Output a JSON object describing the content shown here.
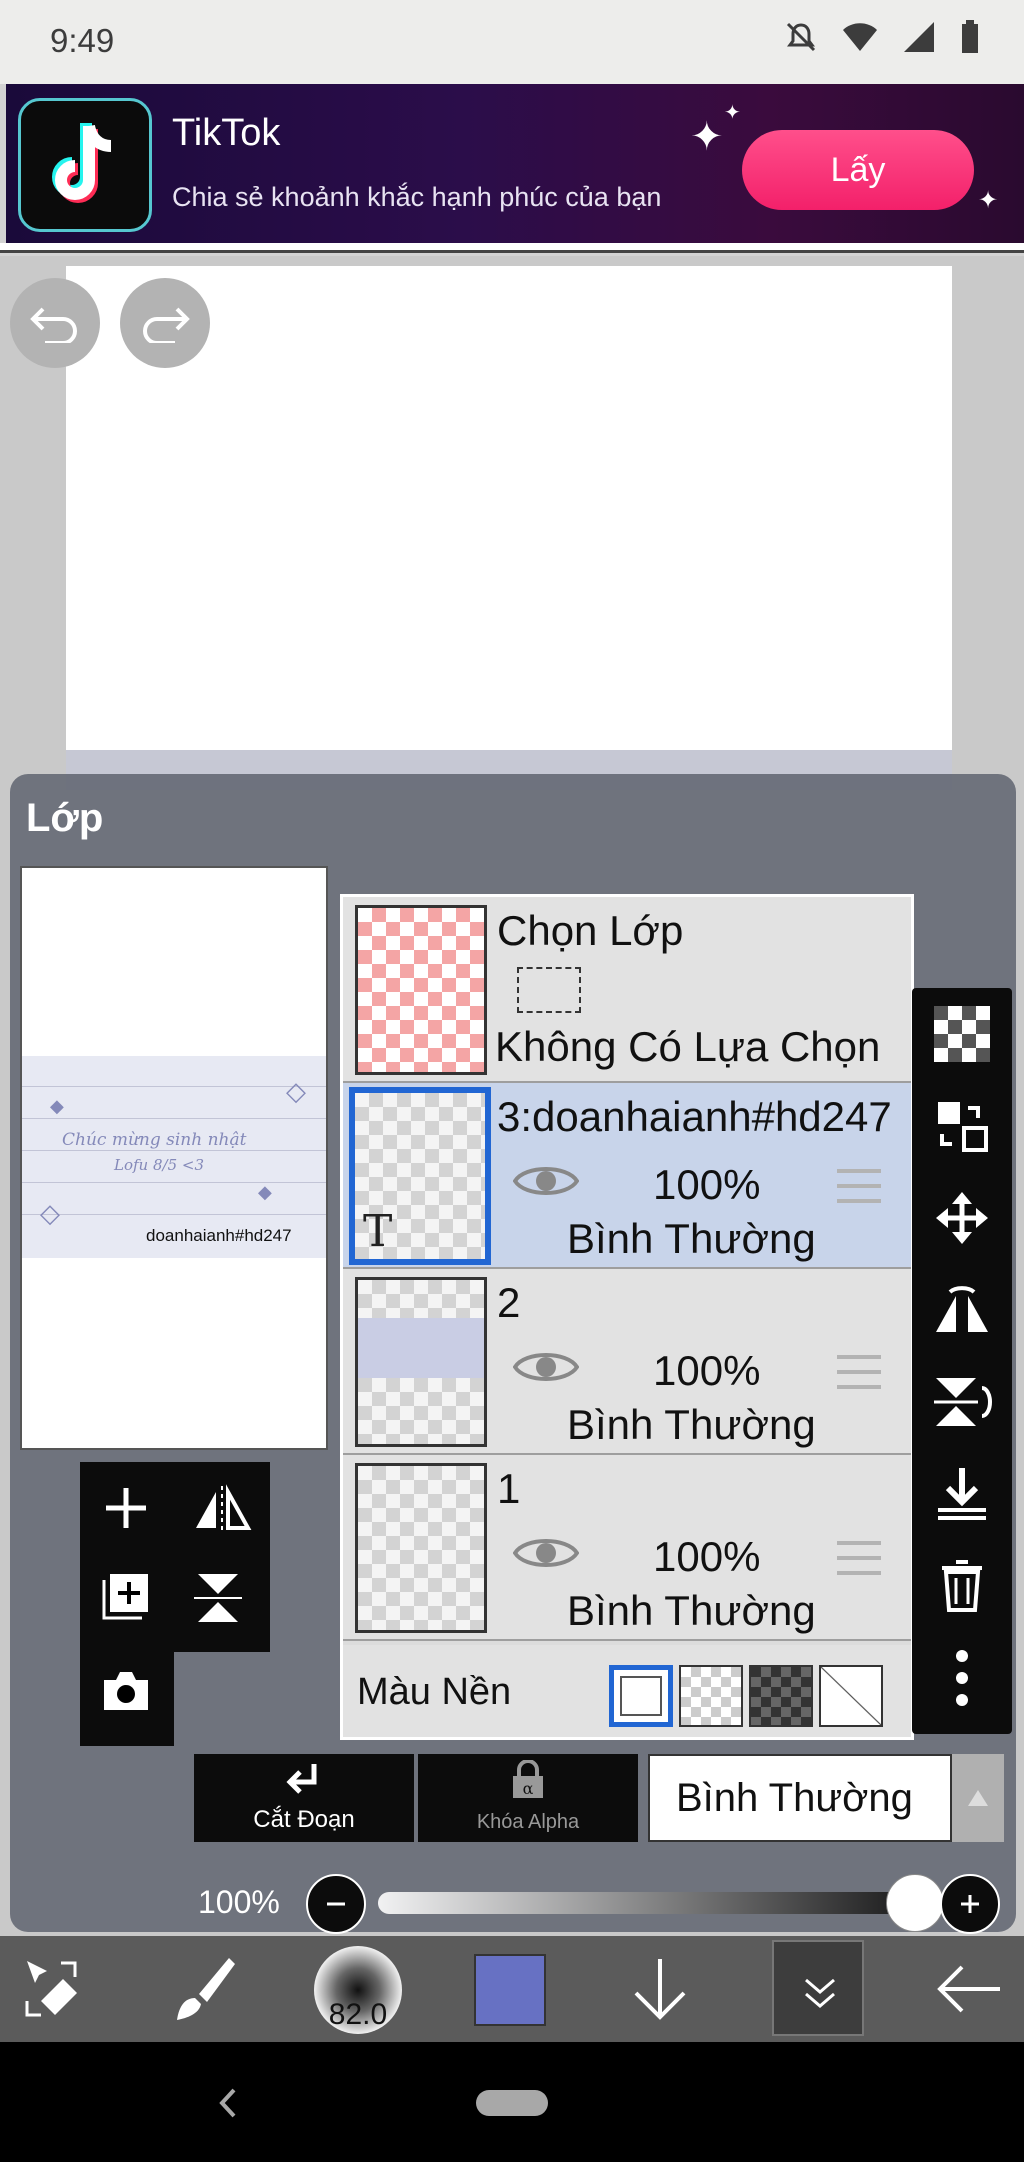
{
  "status_bar": {
    "time": "9:49",
    "icons": [
      "mute-icon",
      "wifi-icon",
      "signal-icon",
      "battery-icon"
    ]
  },
  "ad": {
    "app_name": "TikTok",
    "tagline": "Chia sẻ khoảnh khắc hạnh phúc của bạn",
    "button_label": "Lấy"
  },
  "layer_panel": {
    "title": "Lớp",
    "preview_caption": "doanhaianh#hd247",
    "preview_script_line1": "Chúc mừng sinh nhật",
    "preview_script_line2": "Lofu 8/5 <3",
    "selection_row": {
      "title": "Chọn Lớp",
      "status": "Không Có Lựa Chọn"
    },
    "layers": [
      {
        "name": "3:doanhaianh#hd247",
        "opacity": "100%",
        "blend_mode": "Bình Thường",
        "selected": true,
        "thumb_letter": "T"
      },
      {
        "name": "2",
        "opacity": "100%",
        "blend_mode": "Bình Thường",
        "selected": false
      },
      {
        "name": "1",
        "opacity": "100%",
        "blend_mode": "Bình Thường",
        "selected": false
      }
    ],
    "background_label": "Màu Nền",
    "clipping_label": "Cắt Đoạn",
    "alpha_lock_label": "Khóa Alpha",
    "blend_mode_value": "Bình Thường",
    "opacity_label": "100%",
    "opacity_value": 1.0
  },
  "toolbar": {
    "brush_size": "82.0",
    "color": "#6771c3"
  },
  "colors": {
    "accent": "#2166d3",
    "ad_button": "#f3206a",
    "selected_row": "#c8d4ea"
  }
}
